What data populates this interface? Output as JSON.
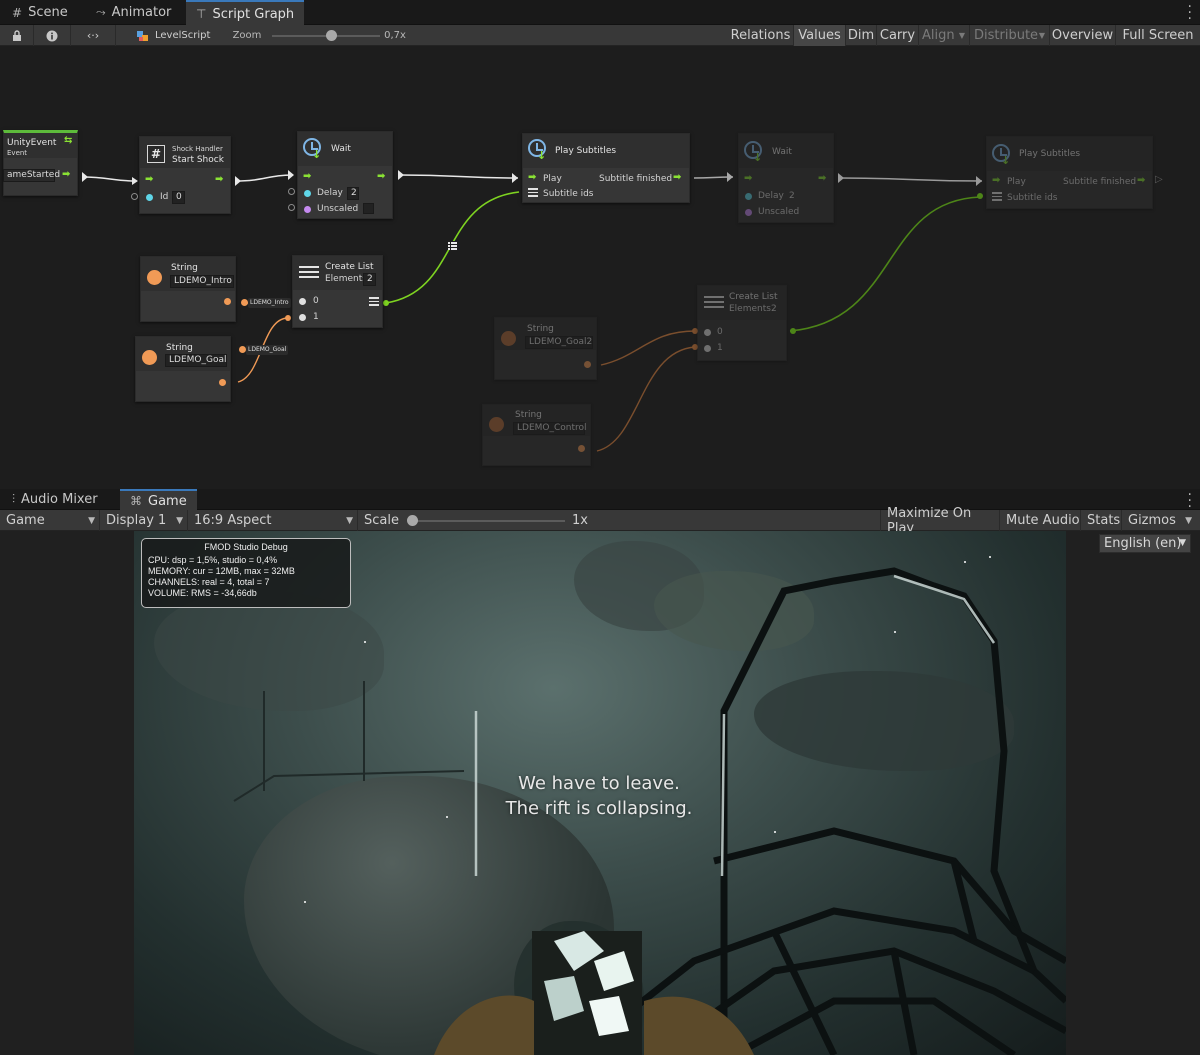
{
  "top_tabs": [
    {
      "label": "Scene",
      "icon": "grid-icon"
    },
    {
      "label": "Animator",
      "icon": "animator-icon"
    },
    {
      "label": "Script Graph",
      "icon": "hierarchy-icon",
      "active": true
    }
  ],
  "graph_toolbar": {
    "asset_name": "LevelScript",
    "zoom_label": "Zoom",
    "zoom_value": "0,7x",
    "zoom_fraction": 0.55,
    "buttons": [
      {
        "label": "Relations",
        "state": "normal"
      },
      {
        "label": "Values",
        "state": "on"
      },
      {
        "label": "Dim",
        "state": "normal"
      },
      {
        "label": "Carry",
        "state": "normal"
      },
      {
        "label": "Align",
        "state": "disabled"
      },
      {
        "label": "Distribute",
        "state": "disabled"
      },
      {
        "label": "Overview",
        "state": "normal"
      },
      {
        "label": "Full Screen",
        "state": "normal"
      }
    ]
  },
  "nodes": {
    "unity_event": {
      "title": "UnityEvent",
      "subtitle": "Event",
      "value": "ameStarted"
    },
    "shock_handler": {
      "subtitle": "Shock Handler",
      "title": "Start Shock",
      "port_label": "Id",
      "port_value": "0"
    },
    "wait_1": {
      "title": "Wait",
      "delay_label": "Delay",
      "delay_value": "2",
      "unscaled_label": "Unscaled"
    },
    "play_subtitles_1": {
      "title": "Play Subtitles",
      "in_label": "Play",
      "out_label": "Subtitle  finished",
      "list_label": "Subtitle  ids"
    },
    "wait_2": {
      "title": "Wait",
      "delay_label": "Delay",
      "delay_value": "2",
      "unscaled_label": "Unscaled"
    },
    "play_subtitles_2": {
      "title": "Play Subtitles",
      "in_label": "Play",
      "out_label": "Subtitle  finished",
      "list_label": "Subtitle  ids"
    },
    "string_intro": {
      "title": "String",
      "value": "LDEMO_Intro",
      "pill": "LDEMO_Intro"
    },
    "string_goal": {
      "title": "String",
      "value": "LDEMO_Goal",
      "pill": "LDEMO_Goal"
    },
    "create_list_1": {
      "title": "Create List",
      "elements_label": "Elements",
      "elements_value": "2",
      "port0": "0",
      "port1": "1"
    },
    "string_goal2": {
      "title": "String",
      "value": "LDEMO_Goal2"
    },
    "string_control": {
      "title": "String",
      "value": "LDEMO_Control"
    },
    "create_list_2": {
      "title": "Create List",
      "elements_label": "Elements",
      "elements_value": "2",
      "port0": "0",
      "port1": "1"
    }
  },
  "bottom_tabs": [
    {
      "label": "Audio Mixer",
      "icon": "mixer-icon"
    },
    {
      "label": "Game",
      "icon": "gamepad-icon",
      "active": true
    }
  ],
  "game_toolbar": {
    "mode": "Game",
    "display": "Display 1",
    "aspect": "16:9 Aspect",
    "scale_label": "Scale",
    "scale_value": "1x",
    "buttons": [
      "Maximize On Play",
      "Mute Audio",
      "Stats",
      "Gizmos"
    ]
  },
  "language_dropdown": "English (en)",
  "fmod_debug": {
    "title": "FMOD Studio Debug",
    "lines": [
      "CPU: dsp = 1,5%, studio = 0,4%",
      "MEMORY: cur = 12MB, max = 32MB",
      "CHANNELS: real = 4, total = 7",
      "VOLUME: RMS = -34,66db"
    ]
  },
  "subtitle_lines": [
    "We have to leave.",
    "The rift is collapsing."
  ],
  "colors": {
    "flow_arrow": "#8ae234",
    "string_port": "#f09a56",
    "int_port": "#5fd6e8",
    "bool_port": "#c58af0",
    "list_wire": "#7ed321",
    "accent_tab": "#3a79bb"
  }
}
